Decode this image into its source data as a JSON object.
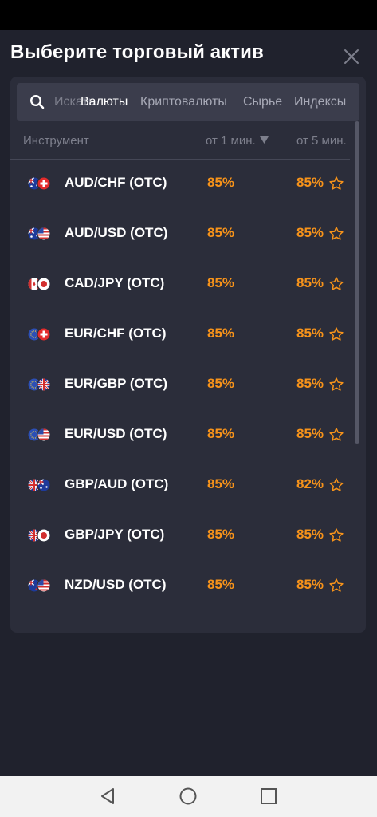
{
  "header": {
    "title": "Выберите торговый актив"
  },
  "search": {
    "placeholder": "Искать"
  },
  "tabs": [
    {
      "label": "Валюты",
      "active": true
    },
    {
      "label": "Криптовалюты",
      "active": false
    },
    {
      "label": "Сырье",
      "active": false
    },
    {
      "label": "Индексы",
      "active": false
    }
  ],
  "table": {
    "columns": {
      "instrument": "Инструмент",
      "payout_1m": "от 1 мин.",
      "payout_5m": "от 5 мин."
    },
    "rows": [
      {
        "name": "AUD/CHF (OTC)",
        "payout_1m": "85%",
        "payout_5m": "85%",
        "flags": [
          "AU",
          "CH"
        ]
      },
      {
        "name": "AUD/USD (OTC)",
        "payout_1m": "85%",
        "payout_5m": "85%",
        "flags": [
          "AU",
          "US"
        ]
      },
      {
        "name": "CAD/JPY (OTC)",
        "payout_1m": "85%",
        "payout_5m": "85%",
        "flags": [
          "CA",
          "JP"
        ]
      },
      {
        "name": "EUR/CHF (OTC)",
        "payout_1m": "85%",
        "payout_5m": "85%",
        "flags": [
          "EU",
          "CH"
        ]
      },
      {
        "name": "EUR/GBP (OTC)",
        "payout_1m": "85%",
        "payout_5m": "85%",
        "flags": [
          "EU",
          "GB"
        ]
      },
      {
        "name": "EUR/USD (OTC)",
        "payout_1m": "85%",
        "payout_5m": "85%",
        "flags": [
          "EU",
          "US"
        ]
      },
      {
        "name": "GBP/AUD (OTC)",
        "payout_1m": "85%",
        "payout_5m": "82%",
        "flags": [
          "GB",
          "AU"
        ]
      },
      {
        "name": "GBP/JPY (OTC)",
        "payout_1m": "85%",
        "payout_5m": "85%",
        "flags": [
          "GB",
          "JP"
        ]
      },
      {
        "name": "NZD/USD (OTC)",
        "payout_1m": "85%",
        "payout_5m": "85%",
        "flags": [
          "NZ",
          "US"
        ]
      }
    ]
  },
  "icons": {
    "close": "close-icon",
    "search": "search-icon",
    "sort": "sort-desc-icon",
    "favorite": "star-outline-icon",
    "nav": [
      "back-icon",
      "home-icon",
      "recents-icon"
    ]
  },
  "colors": {
    "background": "#20222d",
    "panel": "#2b2d3a",
    "search_bg": "#3b3d4c",
    "payout": "#f7931a",
    "muted_text": "#7d7f8c",
    "tab_text": "#a7a9b6"
  }
}
